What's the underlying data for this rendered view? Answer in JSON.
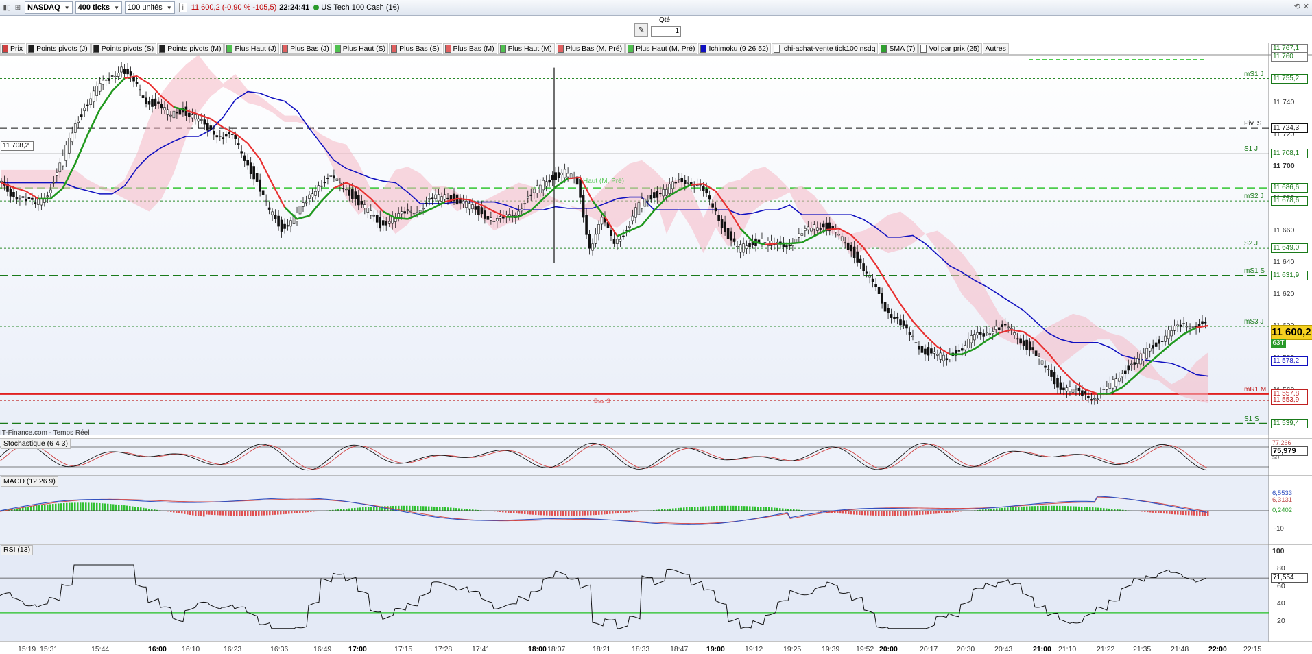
{
  "toolbar": {
    "instrument": "NASDAQ",
    "ticks": "400 ticks",
    "units": "100 unités",
    "price_info": "11 600,2 (-0,90 % -105,5)",
    "time": "22:24:41",
    "instrument_name": "US Tech 100 Cash (1€)"
  },
  "order": {
    "qty_label": "Qté",
    "qty_value": "1"
  },
  "legend": [
    {
      "label": "Prix",
      "color": "#d04040"
    },
    {
      "label": "Points pivots (J)",
      "color": "#202020"
    },
    {
      "label": "Points pivots (S)",
      "color": "#202020"
    },
    {
      "label": "Points pivots (M)",
      "color": "#202020"
    },
    {
      "label": "Plus Haut (J)",
      "color": "#50c050"
    },
    {
      "label": "Plus Bas (J)",
      "color": "#e06060"
    },
    {
      "label": "Plus Haut (S)",
      "color": "#50c050"
    },
    {
      "label": "Plus Bas (S)",
      "color": "#e06060"
    },
    {
      "label": "Plus Bas (M)",
      "color": "#e06060"
    },
    {
      "label": "Plus Haut (M)",
      "color": "#50c050"
    },
    {
      "label": "Plus Bas (M, Pré)",
      "color": "#e06060"
    },
    {
      "label": "Plus Haut (M, Pré)",
      "color": "#50c050"
    },
    {
      "label": "Ichimoku (9 26 52)",
      "color": "#1010c0"
    },
    {
      "label": "ichi-achat-vente tick100 nsdq",
      "color": "#ffffff"
    },
    {
      "label": "SMA (7)",
      "color": "#30a030"
    },
    {
      "label": "Vol par prix (25)",
      "color": "#ffffff"
    },
    {
      "label": "Autres",
      "color": "none"
    }
  ],
  "price_axis": {
    "ticks": [
      "11 740",
      "11 720",
      "11 700",
      "11 680",
      "11 660",
      "11 640",
      "11 620",
      "11 600",
      "11 580",
      "11 560",
      "11 540"
    ],
    "levels": [
      {
        "name": "mS1 J",
        "value": "11 755,2"
      },
      {
        "name": "Piv. S",
        "value": "11 724,3"
      },
      {
        "name": "S1 J",
        "value": "11 708,1"
      },
      {
        "name": "",
        "value": "11 686,6"
      },
      {
        "name": "mS2 J",
        "value": "11 678,6"
      },
      {
        "name": "S2 J",
        "value": "11 649,0"
      },
      {
        "name": "mS1 S",
        "value": "11 631,9"
      },
      {
        "name": "mS3 J",
        "value": "11 600,2"
      },
      {
        "name": "",
        "value": "11 578,2"
      },
      {
        "name": "mR1 M",
        "value": "11 557,8"
      },
      {
        "name": "",
        "value": "11 553,9"
      },
      {
        "name": "S1 S",
        "value": "11 539,4"
      }
    ],
    "top_values": [
      "11 767,1",
      "11 760"
    ],
    "current_price": "11 600,2",
    "current_sub": "63T",
    "crosshair_value": "11 708,2",
    "haut_label": "Haut (M, Pré)",
    "bas_label": "Bas S"
  },
  "source": "IT-Finance.com - Temps Réel",
  "stochastic": {
    "title": "Stochastique (6 4 3)",
    "value": "75,979",
    "top": "77,266",
    "mid": "50"
  },
  "macd": {
    "title": "MACD (12 26 9)",
    "v1": "6,5533",
    "v2": "6,3131",
    "v3": "0,2402",
    "v4": "-10"
  },
  "rsi": {
    "title": "RSI (13)",
    "value": "71,554",
    "ticks": [
      "100",
      "80",
      "60",
      "40",
      "20"
    ]
  },
  "time_axis": [
    {
      "label": "15:19",
      "bold": false
    },
    {
      "label": "15:31",
      "bold": false
    },
    {
      "label": "15:44",
      "bold": false
    },
    {
      "label": "16:00",
      "bold": true
    },
    {
      "label": "16:10",
      "bold": false
    },
    {
      "label": "16:23",
      "bold": false
    },
    {
      "label": "16:36",
      "bold": false
    },
    {
      "label": "16:49",
      "bold": false
    },
    {
      "label": "17:00",
      "bold": true
    },
    {
      "label": "17:15",
      "bold": false
    },
    {
      "label": "17:28",
      "bold": false
    },
    {
      "label": "17:41",
      "bold": false
    },
    {
      "label": "18:00",
      "bold": true
    },
    {
      "label": "18:07",
      "bold": false
    },
    {
      "label": "18:21",
      "bold": false
    },
    {
      "label": "18:33",
      "bold": false
    },
    {
      "label": "18:47",
      "bold": false
    },
    {
      "label": "19:00",
      "bold": true
    },
    {
      "label": "19:12",
      "bold": false
    },
    {
      "label": "19:25",
      "bold": false
    },
    {
      "label": "19:39",
      "bold": false
    },
    {
      "label": "19:52",
      "bold": false
    },
    {
      "label": "20:00",
      "bold": true
    },
    {
      "label": "20:17",
      "bold": false
    },
    {
      "label": "20:30",
      "bold": false
    },
    {
      "label": "20:43",
      "bold": false
    },
    {
      "label": "21:00",
      "bold": true
    },
    {
      "label": "21:10",
      "bold": false
    },
    {
      "label": "21:22",
      "bold": false
    },
    {
      "label": "21:35",
      "bold": false
    },
    {
      "label": "21:48",
      "bold": false
    },
    {
      "label": "22:00",
      "bold": true
    },
    {
      "label": "22:15",
      "bold": false
    }
  ],
  "chart_data": {
    "type": "line",
    "series_price": [
      11690,
      11684,
      11680,
      11676,
      11684,
      11700,
      11722,
      11738,
      11748,
      11756,
      11762,
      11752,
      11742,
      11738,
      11732,
      11736,
      11730,
      11724,
      11720,
      11718,
      11706,
      11690,
      11672,
      11662,
      11668,
      11678,
      11690,
      11692,
      11688,
      11680,
      11672,
      11664,
      11668,
      11670,
      11674,
      11678,
      11682,
      11680,
      11676,
      11672,
      11668,
      11666,
      11672,
      11680,
      11688,
      11694,
      11696,
      11690,
      11650,
      11666,
      11654,
      11660,
      11676,
      11682,
      11684,
      11690,
      11692,
      11686,
      11676,
      11660,
      11648,
      11652,
      11654,
      11650,
      11652,
      11656,
      11662,
      11664,
      11658,
      11650,
      11640,
      11626,
      11612,
      11604,
      11594,
      11586,
      11582,
      11580,
      11586,
      11592,
      11596,
      11600,
      11598,
      11592,
      11584,
      11574,
      11564,
      11560,
      11558,
      11556,
      11560,
      11570,
      11576,
      11582,
      11590,
      11596,
      11600,
      11602,
      11600
    ]
  }
}
